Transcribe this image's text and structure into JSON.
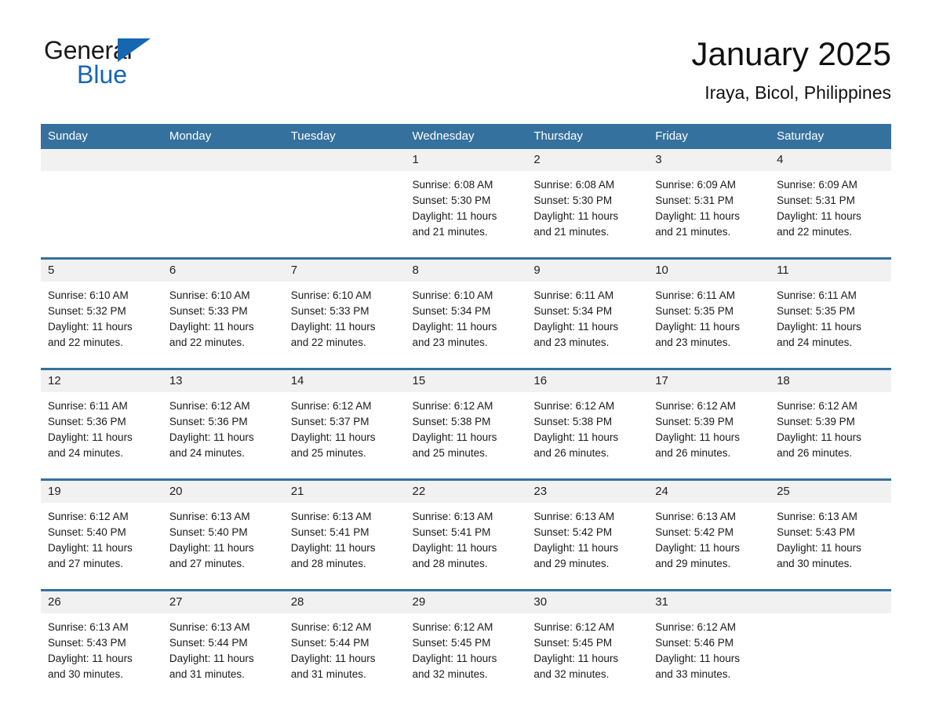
{
  "brand": {
    "word_one": "General",
    "word_two": "Blue",
    "triangle_icon": "triangle-logo-icon",
    "brand_blue": "#1567b2"
  },
  "header": {
    "title": "January 2025",
    "location": "Iraya, Bicol, Philippines"
  },
  "theme": {
    "header_blue": "#35719e",
    "daynum_band": "#f1f1f1",
    "text": "#1a1a1a",
    "page_background": "#ffffff"
  },
  "calendar": {
    "weekday_headers": [
      "Sunday",
      "Monday",
      "Tuesday",
      "Wednesday",
      "Thursday",
      "Friday",
      "Saturday"
    ],
    "weeks": [
      [
        {
          "day": "",
          "blank": true,
          "sunrise": "",
          "sunset": "",
          "daylight_line1": "",
          "daylight_line2": ""
        },
        {
          "day": "",
          "blank": true,
          "sunrise": "",
          "sunset": "",
          "daylight_line1": "",
          "daylight_line2": ""
        },
        {
          "day": "",
          "blank": true,
          "sunrise": "",
          "sunset": "",
          "daylight_line1": "",
          "daylight_line2": ""
        },
        {
          "day": "1",
          "blank": false,
          "sunrise": "Sunrise: 6:08 AM",
          "sunset": "Sunset: 5:30 PM",
          "daylight_line1": "Daylight: 11 hours",
          "daylight_line2": "and 21 minutes."
        },
        {
          "day": "2",
          "blank": false,
          "sunrise": "Sunrise: 6:08 AM",
          "sunset": "Sunset: 5:30 PM",
          "daylight_line1": "Daylight: 11 hours",
          "daylight_line2": "and 21 minutes."
        },
        {
          "day": "3",
          "blank": false,
          "sunrise": "Sunrise: 6:09 AM",
          "sunset": "Sunset: 5:31 PM",
          "daylight_line1": "Daylight: 11 hours",
          "daylight_line2": "and 21 minutes."
        },
        {
          "day": "4",
          "blank": false,
          "sunrise": "Sunrise: 6:09 AM",
          "sunset": "Sunset: 5:31 PM",
          "daylight_line1": "Daylight: 11 hours",
          "daylight_line2": "and 22 minutes."
        }
      ],
      [
        {
          "day": "5",
          "blank": false,
          "sunrise": "Sunrise: 6:10 AM",
          "sunset": "Sunset: 5:32 PM",
          "daylight_line1": "Daylight: 11 hours",
          "daylight_line2": "and 22 minutes."
        },
        {
          "day": "6",
          "blank": false,
          "sunrise": "Sunrise: 6:10 AM",
          "sunset": "Sunset: 5:33 PM",
          "daylight_line1": "Daylight: 11 hours",
          "daylight_line2": "and 22 minutes."
        },
        {
          "day": "7",
          "blank": false,
          "sunrise": "Sunrise: 6:10 AM",
          "sunset": "Sunset: 5:33 PM",
          "daylight_line1": "Daylight: 11 hours",
          "daylight_line2": "and 22 minutes."
        },
        {
          "day": "8",
          "blank": false,
          "sunrise": "Sunrise: 6:10 AM",
          "sunset": "Sunset: 5:34 PM",
          "daylight_line1": "Daylight: 11 hours",
          "daylight_line2": "and 23 minutes."
        },
        {
          "day": "9",
          "blank": false,
          "sunrise": "Sunrise: 6:11 AM",
          "sunset": "Sunset: 5:34 PM",
          "daylight_line1": "Daylight: 11 hours",
          "daylight_line2": "and 23 minutes."
        },
        {
          "day": "10",
          "blank": false,
          "sunrise": "Sunrise: 6:11 AM",
          "sunset": "Sunset: 5:35 PM",
          "daylight_line1": "Daylight: 11 hours",
          "daylight_line2": "and 23 minutes."
        },
        {
          "day": "11",
          "blank": false,
          "sunrise": "Sunrise: 6:11 AM",
          "sunset": "Sunset: 5:35 PM",
          "daylight_line1": "Daylight: 11 hours",
          "daylight_line2": "and 24 minutes."
        }
      ],
      [
        {
          "day": "12",
          "blank": false,
          "sunrise": "Sunrise: 6:11 AM",
          "sunset": "Sunset: 5:36 PM",
          "daylight_line1": "Daylight: 11 hours",
          "daylight_line2": "and 24 minutes."
        },
        {
          "day": "13",
          "blank": false,
          "sunrise": "Sunrise: 6:12 AM",
          "sunset": "Sunset: 5:36 PM",
          "daylight_line1": "Daylight: 11 hours",
          "daylight_line2": "and 24 minutes."
        },
        {
          "day": "14",
          "blank": false,
          "sunrise": "Sunrise: 6:12 AM",
          "sunset": "Sunset: 5:37 PM",
          "daylight_line1": "Daylight: 11 hours",
          "daylight_line2": "and 25 minutes."
        },
        {
          "day": "15",
          "blank": false,
          "sunrise": "Sunrise: 6:12 AM",
          "sunset": "Sunset: 5:38 PM",
          "daylight_line1": "Daylight: 11 hours",
          "daylight_line2": "and 25 minutes."
        },
        {
          "day": "16",
          "blank": false,
          "sunrise": "Sunrise: 6:12 AM",
          "sunset": "Sunset: 5:38 PM",
          "daylight_line1": "Daylight: 11 hours",
          "daylight_line2": "and 26 minutes."
        },
        {
          "day": "17",
          "blank": false,
          "sunrise": "Sunrise: 6:12 AM",
          "sunset": "Sunset: 5:39 PM",
          "daylight_line1": "Daylight: 11 hours",
          "daylight_line2": "and 26 minutes."
        },
        {
          "day": "18",
          "blank": false,
          "sunrise": "Sunrise: 6:12 AM",
          "sunset": "Sunset: 5:39 PM",
          "daylight_line1": "Daylight: 11 hours",
          "daylight_line2": "and 26 minutes."
        }
      ],
      [
        {
          "day": "19",
          "blank": false,
          "sunrise": "Sunrise: 6:12 AM",
          "sunset": "Sunset: 5:40 PM",
          "daylight_line1": "Daylight: 11 hours",
          "daylight_line2": "and 27 minutes."
        },
        {
          "day": "20",
          "blank": false,
          "sunrise": "Sunrise: 6:13 AM",
          "sunset": "Sunset: 5:40 PM",
          "daylight_line1": "Daylight: 11 hours",
          "daylight_line2": "and 27 minutes."
        },
        {
          "day": "21",
          "blank": false,
          "sunrise": "Sunrise: 6:13 AM",
          "sunset": "Sunset: 5:41 PM",
          "daylight_line1": "Daylight: 11 hours",
          "daylight_line2": "and 28 minutes."
        },
        {
          "day": "22",
          "blank": false,
          "sunrise": "Sunrise: 6:13 AM",
          "sunset": "Sunset: 5:41 PM",
          "daylight_line1": "Daylight: 11 hours",
          "daylight_line2": "and 28 minutes."
        },
        {
          "day": "23",
          "blank": false,
          "sunrise": "Sunrise: 6:13 AM",
          "sunset": "Sunset: 5:42 PM",
          "daylight_line1": "Daylight: 11 hours",
          "daylight_line2": "and 29 minutes."
        },
        {
          "day": "24",
          "blank": false,
          "sunrise": "Sunrise: 6:13 AM",
          "sunset": "Sunset: 5:42 PM",
          "daylight_line1": "Daylight: 11 hours",
          "daylight_line2": "and 29 minutes."
        },
        {
          "day": "25",
          "blank": false,
          "sunrise": "Sunrise: 6:13 AM",
          "sunset": "Sunset: 5:43 PM",
          "daylight_line1": "Daylight: 11 hours",
          "daylight_line2": "and 30 minutes."
        }
      ],
      [
        {
          "day": "26",
          "blank": false,
          "sunrise": "Sunrise: 6:13 AM",
          "sunset": "Sunset: 5:43 PM",
          "daylight_line1": "Daylight: 11 hours",
          "daylight_line2": "and 30 minutes."
        },
        {
          "day": "27",
          "blank": false,
          "sunrise": "Sunrise: 6:13 AM",
          "sunset": "Sunset: 5:44 PM",
          "daylight_line1": "Daylight: 11 hours",
          "daylight_line2": "and 31 minutes."
        },
        {
          "day": "28",
          "blank": false,
          "sunrise": "Sunrise: 6:12 AM",
          "sunset": "Sunset: 5:44 PM",
          "daylight_line1": "Daylight: 11 hours",
          "daylight_line2": "and 31 minutes."
        },
        {
          "day": "29",
          "blank": false,
          "sunrise": "Sunrise: 6:12 AM",
          "sunset": "Sunset: 5:45 PM",
          "daylight_line1": "Daylight: 11 hours",
          "daylight_line2": "and 32 minutes."
        },
        {
          "day": "30",
          "blank": false,
          "sunrise": "Sunrise: 6:12 AM",
          "sunset": "Sunset: 5:45 PM",
          "daylight_line1": "Daylight: 11 hours",
          "daylight_line2": "and 32 minutes."
        },
        {
          "day": "31",
          "blank": false,
          "sunrise": "Sunrise: 6:12 AM",
          "sunset": "Sunset: 5:46 PM",
          "daylight_line1": "Daylight: 11 hours",
          "daylight_line2": "and 33 minutes."
        },
        {
          "day": "",
          "blank": true,
          "sunrise": "",
          "sunset": "",
          "daylight_line1": "",
          "daylight_line2": ""
        }
      ]
    ]
  }
}
